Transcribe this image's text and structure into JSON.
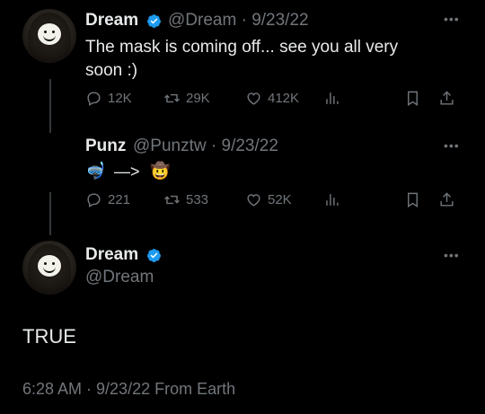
{
  "tweets": [
    {
      "name": "Dream",
      "handle": "@Dream",
      "dot": "·",
      "date": "9/23/22",
      "text_line1": "The mask is coming off... see you all very",
      "text_line2": "soon :)",
      "replies": "12K",
      "retweets": "29K",
      "likes": "412K"
    },
    {
      "name": "Punz",
      "handle": "@Punztw",
      "dot": "·",
      "date": "9/23/22",
      "arrow": "—>",
      "replies": "221",
      "retweets": "533",
      "likes": "52K"
    }
  ],
  "main": {
    "name": "Dream",
    "handle": "@Dream",
    "text": "TRUE",
    "meta": "6:28 AM · 9/23/22 From Earth"
  },
  "icons": {
    "more": "more-icon",
    "verified": "verified-badge-icon",
    "reply": "reply-icon",
    "retweet": "retweet-icon",
    "like": "heart-icon",
    "views": "analytics-icon",
    "bookmark": "bookmark-icon",
    "share": "share-icon"
  },
  "colors": {
    "background": "#000000",
    "text": "#e7e9ea",
    "secondary": "#71767b",
    "verified": "#1d9bf0"
  }
}
